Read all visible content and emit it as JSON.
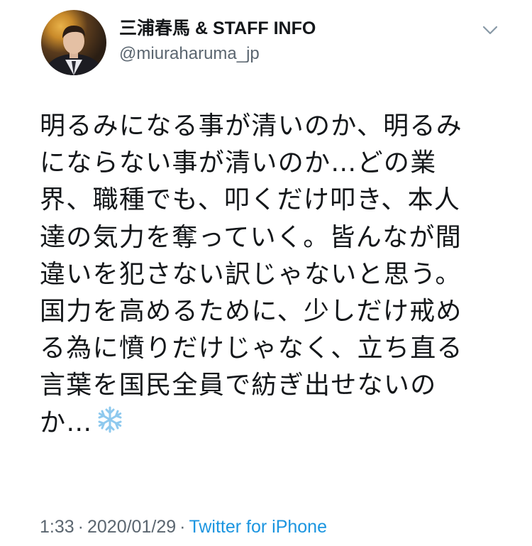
{
  "author": {
    "display_name": "三浦春馬 & STAFF INFO",
    "handle": "@miuraharuma_jp"
  },
  "tweet": {
    "lines": [
      "明るみになる事が清いのか、明るみ",
      "にならない事が清いのか…どの業",
      "界、職種でも、叩くだけ叩き、本人",
      "達の気力を奪っていく。皆んなが間",
      "違いを犯さない訳じゃないと思う。",
      "国力を高めるために、少しだけ戒め",
      "る為に憤りだけじゃなく、立ち直る",
      "言葉を国民全員で紡ぎ出せないの",
      "か…"
    ],
    "trailing_emoji": "snowflake-icon"
  },
  "meta": {
    "time": "1:33",
    "separator": "·",
    "date": "2020/01/29",
    "source": "Twitter for iPhone"
  },
  "colors": {
    "text": "#14171a",
    "secondary": "#5b6670",
    "link": "#1b95e0"
  }
}
